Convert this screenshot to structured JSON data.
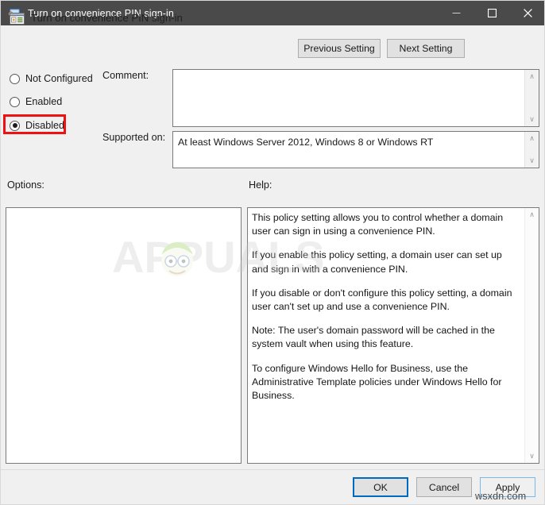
{
  "window": {
    "title": "Turn on convenience PIN sign-in",
    "icon": "policy-monitor-icon",
    "minimize_label": "─",
    "maximize_label": "□",
    "close_label": "✕"
  },
  "header": {
    "title": "Turn on convenience PIN sign-in",
    "icon": "policy-setting-icon",
    "previous_setting_label": "Previous Setting",
    "next_setting_label": "Next Setting"
  },
  "state_options": {
    "items": [
      {
        "label": "Not Configured",
        "checked": false
      },
      {
        "label": "Enabled",
        "checked": false
      },
      {
        "label": "Disabled",
        "checked": true
      }
    ],
    "selected": "Disabled",
    "highlight_color": "#ee1111"
  },
  "fields": {
    "comment_label": "Comment:",
    "comment_value": "",
    "supported_on_label": "Supported on:",
    "supported_on_value": "At least Windows Server 2012, Windows 8 or Windows RT"
  },
  "panes": {
    "options_label": "Options:",
    "options_content": "",
    "help_label": "Help:",
    "help_paragraphs": [
      "This policy setting allows you to control whether a domain user can sign in using a convenience PIN.",
      "If you enable this policy setting, a domain user can set up and sign in with a convenience PIN.",
      "If you disable or don't configure this policy setting, a domain user can't set up and use a convenience PIN.",
      "Note: The user's domain password will be cached in the system vault when using this feature.",
      "To configure Windows Hello for Business, use the Administrative Template policies under Windows Hello for Business."
    ]
  },
  "footer": {
    "ok_label": "OK",
    "cancel_label": "Cancel",
    "apply_label": "Apply"
  },
  "watermarks": {
    "brand": "APPUALS",
    "site": "wsxdn.com"
  },
  "scroll": {
    "up_glyph": "∧",
    "down_glyph": "∨"
  }
}
